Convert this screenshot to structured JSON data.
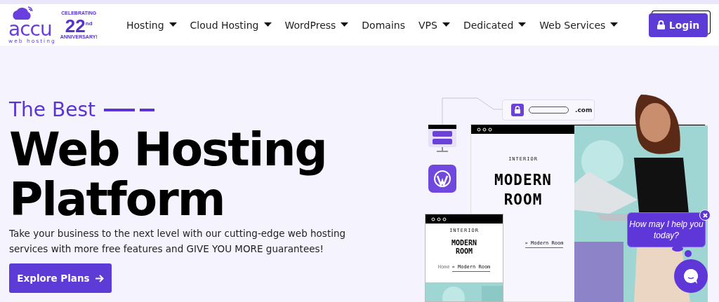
{
  "header": {
    "logo": {
      "wordmark": "accu",
      "tagline": "web hosting",
      "badge_top": "CELEBRATING",
      "badge_number": "22",
      "badge_suffix": "nd",
      "badge_bottom": "ANNIVERSARY!"
    },
    "nav": [
      {
        "label": "Hosting",
        "dropdown": true
      },
      {
        "label": "Cloud Hosting",
        "dropdown": true
      },
      {
        "label": "WordPress",
        "dropdown": true
      },
      {
        "label": "Domains",
        "dropdown": false
      },
      {
        "label": "VPS",
        "dropdown": true
      },
      {
        "label": "Dedicated",
        "dropdown": true
      },
      {
        "label": "Web Services",
        "dropdown": true
      }
    ],
    "login": "Login"
  },
  "hero": {
    "eyebrow": "The Best",
    "title_lines": [
      "Web Hosting",
      "Platform"
    ],
    "description": "Take your business to the next level with our cutting-edge web hosting services with more free features and GIVE YOU MORE guarantees!",
    "cta": "Explore Plans"
  },
  "illustration": {
    "domain_suffix": ".com",
    "large_mockup": {
      "eyebrow": "INTERIOR",
      "title_lines": [
        "MODERN",
        "ROOM"
      ],
      "breadcrumb": "» Modern Room"
    },
    "small_mockup": {
      "eyebrow": "INTERIOR",
      "title_lines": [
        "MODERN",
        "ROOM"
      ],
      "breadcrumb_home": "Home",
      "breadcrumb_current": "» Modern Room"
    }
  },
  "chat": {
    "bubble": "How may I help you today?",
    "closable": true
  }
}
